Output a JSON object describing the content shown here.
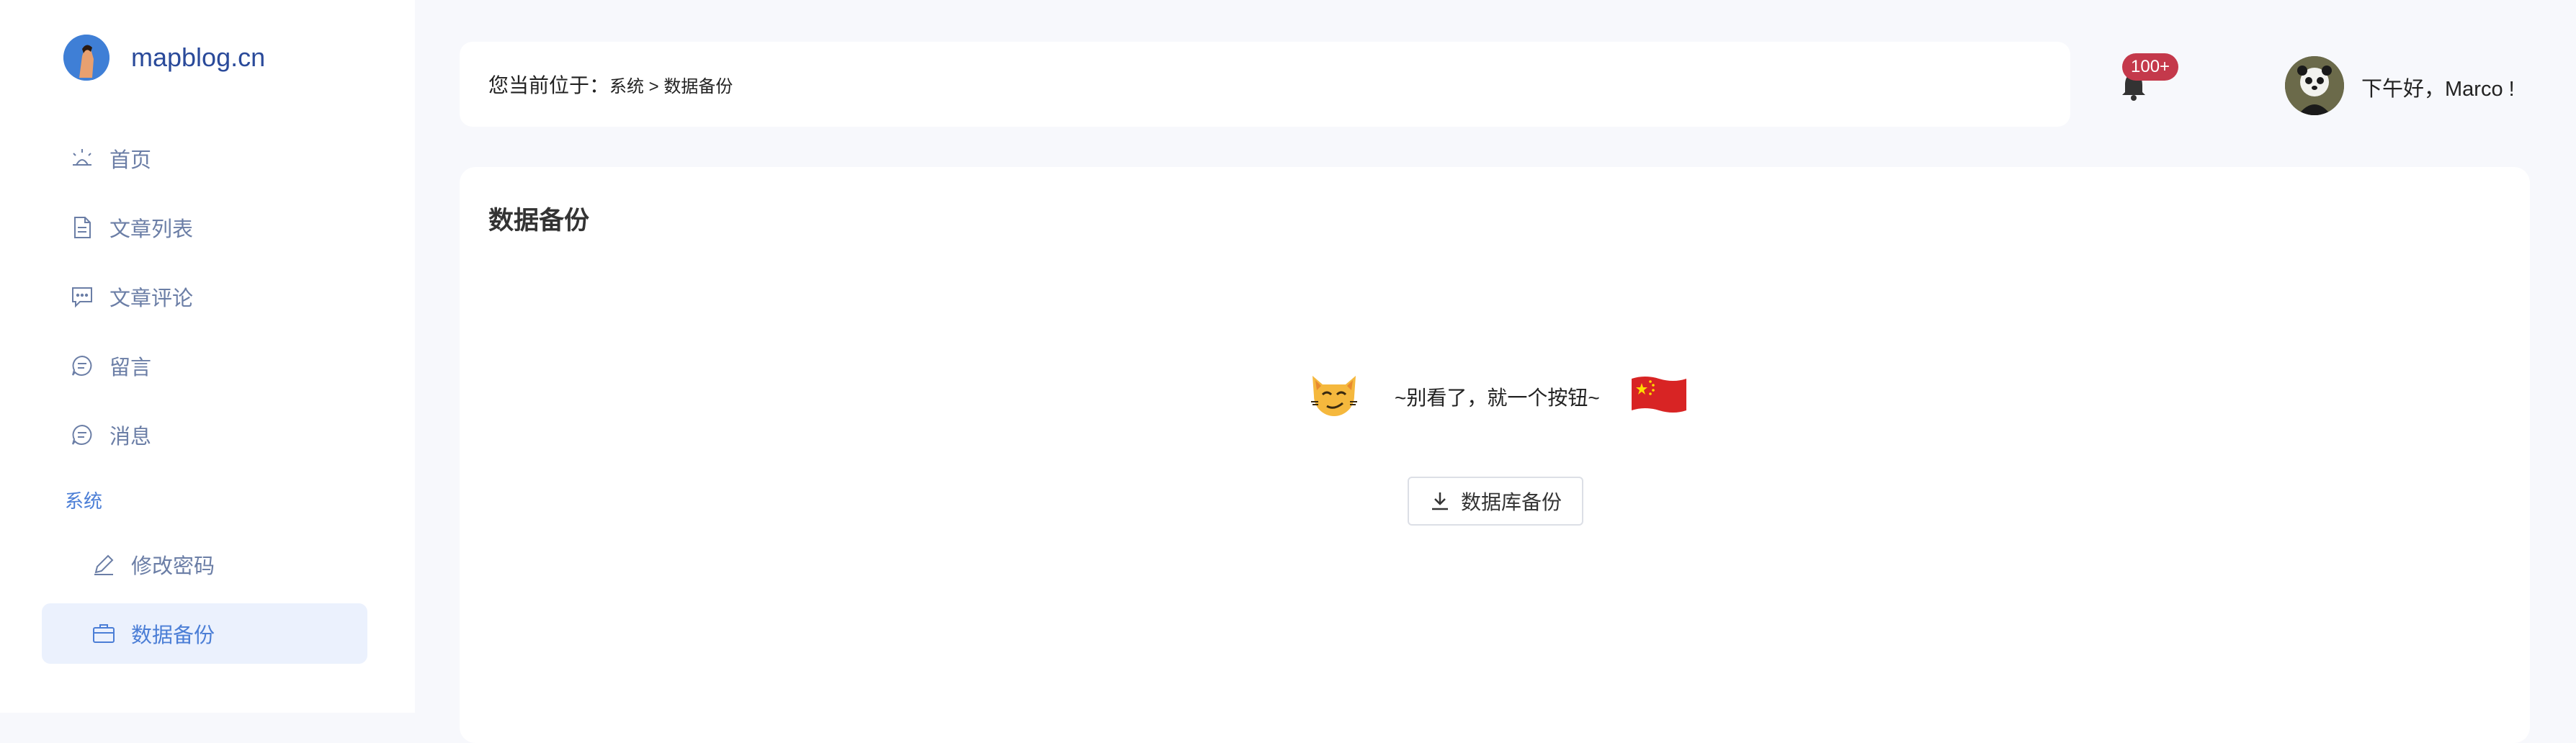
{
  "sidebar": {
    "logo_text": "mapblog.cn",
    "items": [
      {
        "label": "首页",
        "icon": "sunrise-icon"
      },
      {
        "label": "文章列表",
        "icon": "document-icon"
      },
      {
        "label": "文章评论",
        "icon": "comment-icon"
      },
      {
        "label": "留言",
        "icon": "chat-bubble-icon"
      },
      {
        "label": "消息",
        "icon": "message-icon"
      }
    ],
    "group_label": "系统",
    "sub_items": [
      {
        "label": "修改密码",
        "icon": "edit-pen-icon"
      },
      {
        "label": "数据备份",
        "icon": "briefcase-icon",
        "active": true
      }
    ]
  },
  "header": {
    "breadcrumb_prefix": "您当前位于：",
    "breadcrumb_path": "系统 > 数据备份",
    "notification_badge": "100+",
    "greeting": "下午好，Marco !"
  },
  "main": {
    "title": "数据备份",
    "hint_left_emoji": "😼",
    "hint_text": "~别看了，就一个按钮~",
    "hint_right_emoji": "🇨🇳",
    "backup_button_label": "数据库备份"
  },
  "colors": {
    "accent": "#4b7ed6",
    "menu_text": "#6b7ea6",
    "active_bg": "#ebf1fd",
    "badge": "#c4394b",
    "page_bg": "#f7f8fc"
  }
}
